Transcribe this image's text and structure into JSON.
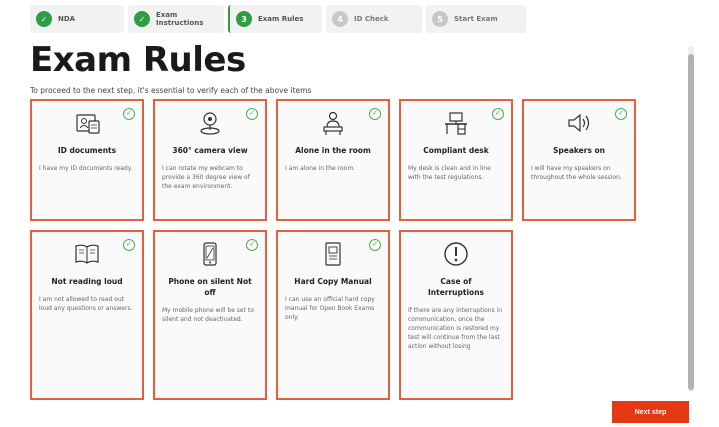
{
  "stepper": [
    {
      "label": "NDA",
      "state": "done",
      "number": "✓"
    },
    {
      "label": "Exam Instructions",
      "state": "done",
      "number": "✓"
    },
    {
      "label": "Exam Rules",
      "state": "current",
      "number": "3"
    },
    {
      "label": "ID Check",
      "state": "todo",
      "number": "4"
    },
    {
      "label": "Start Exam",
      "state": "todo",
      "number": "5"
    }
  ],
  "title": "Exam Rules",
  "subtitle": "To proceed to the next step, it's essential to verify each of the above items",
  "cards": [
    {
      "title": "ID documents",
      "desc": "I have my ID documents ready.",
      "icon": "id-card-icon"
    },
    {
      "title": "360° camera view",
      "desc": "I can rotate my webcam to provide a 360 degree view of the exam environment.",
      "icon": "webcam-icon"
    },
    {
      "title": "Alone in the room",
      "desc": "I am alone in the room.",
      "icon": "person-at-desk-icon"
    },
    {
      "title": "Compliant desk",
      "desc": "My desk is clean and in line with the test regulations.",
      "icon": "desk-icon"
    },
    {
      "title": "Speakers on",
      "desc": "I will have my speakers on throughout the whole session.",
      "icon": "speaker-icon"
    },
    {
      "title": "Not reading loud",
      "desc": "I am not allowed to read out loud any questions or answers.",
      "icon": "open-book-icon"
    },
    {
      "title": "Phone on silent Not off",
      "desc": "My mobile phone will be set to silent and not deactivated.",
      "icon": "mobile-phone-icon"
    },
    {
      "title": "Hard Copy Manual",
      "desc": "I can use an official hard copy manual for Open Book Exams only.",
      "icon": "manual-icon"
    },
    {
      "title": "Case of Interruptions",
      "desc": "If there are any interruptions in communication, once the communication is restored my test will continue from the last action without losing",
      "icon": "exclamation-icon"
    }
  ],
  "next_button": "Next step",
  "colors": {
    "accent": "#e53814",
    "card_border": "#e2603f",
    "success": "#2e9e44"
  }
}
